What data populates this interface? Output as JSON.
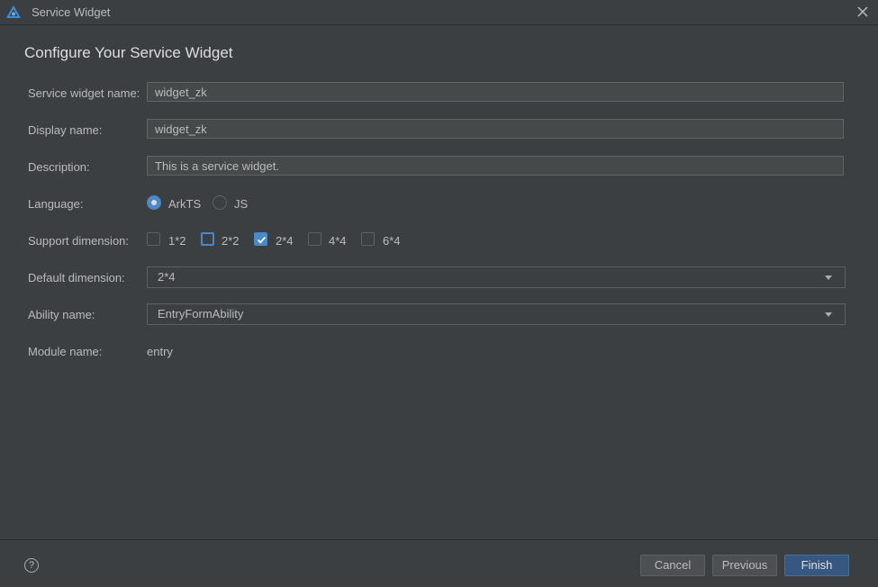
{
  "window": {
    "title": "Service Widget",
    "app_icon": "deveco-logo-icon",
    "close_icon": "close-icon"
  },
  "heading": "Configure Your Service Widget",
  "form": {
    "service_widget_name": {
      "label": "Service widget name:",
      "value": "widget_zk"
    },
    "display_name": {
      "label": "Display name:",
      "value": "widget_zk"
    },
    "description": {
      "label": "Description:",
      "value": "This is a service widget."
    },
    "language": {
      "label": "Language:",
      "options": [
        {
          "label": "ArkTS",
          "selected": true
        },
        {
          "label": "JS",
          "selected": false
        }
      ]
    },
    "support_dimension": {
      "label": "Support dimension:",
      "options": [
        {
          "label": "1*2",
          "checked": false
        },
        {
          "label": "2*2",
          "checked": false,
          "focused": true
        },
        {
          "label": "2*4",
          "checked": true
        },
        {
          "label": "4*4",
          "checked": false
        },
        {
          "label": "6*4",
          "checked": false
        }
      ]
    },
    "default_dimension": {
      "label": "Default dimension:",
      "value": "2*4"
    },
    "ability_name": {
      "label": "Ability name:",
      "value": "EntryFormAbility"
    },
    "module_name": {
      "label": "Module name:",
      "value": "entry"
    }
  },
  "footer": {
    "help_icon": "help-icon",
    "help_glyph": "?",
    "cancel_label": "Cancel",
    "previous_label": "Previous",
    "finish_label": "Finish"
  },
  "colors": {
    "background": "#3c3f41",
    "accent": "#4a88c7",
    "primary_button": "#365880"
  }
}
